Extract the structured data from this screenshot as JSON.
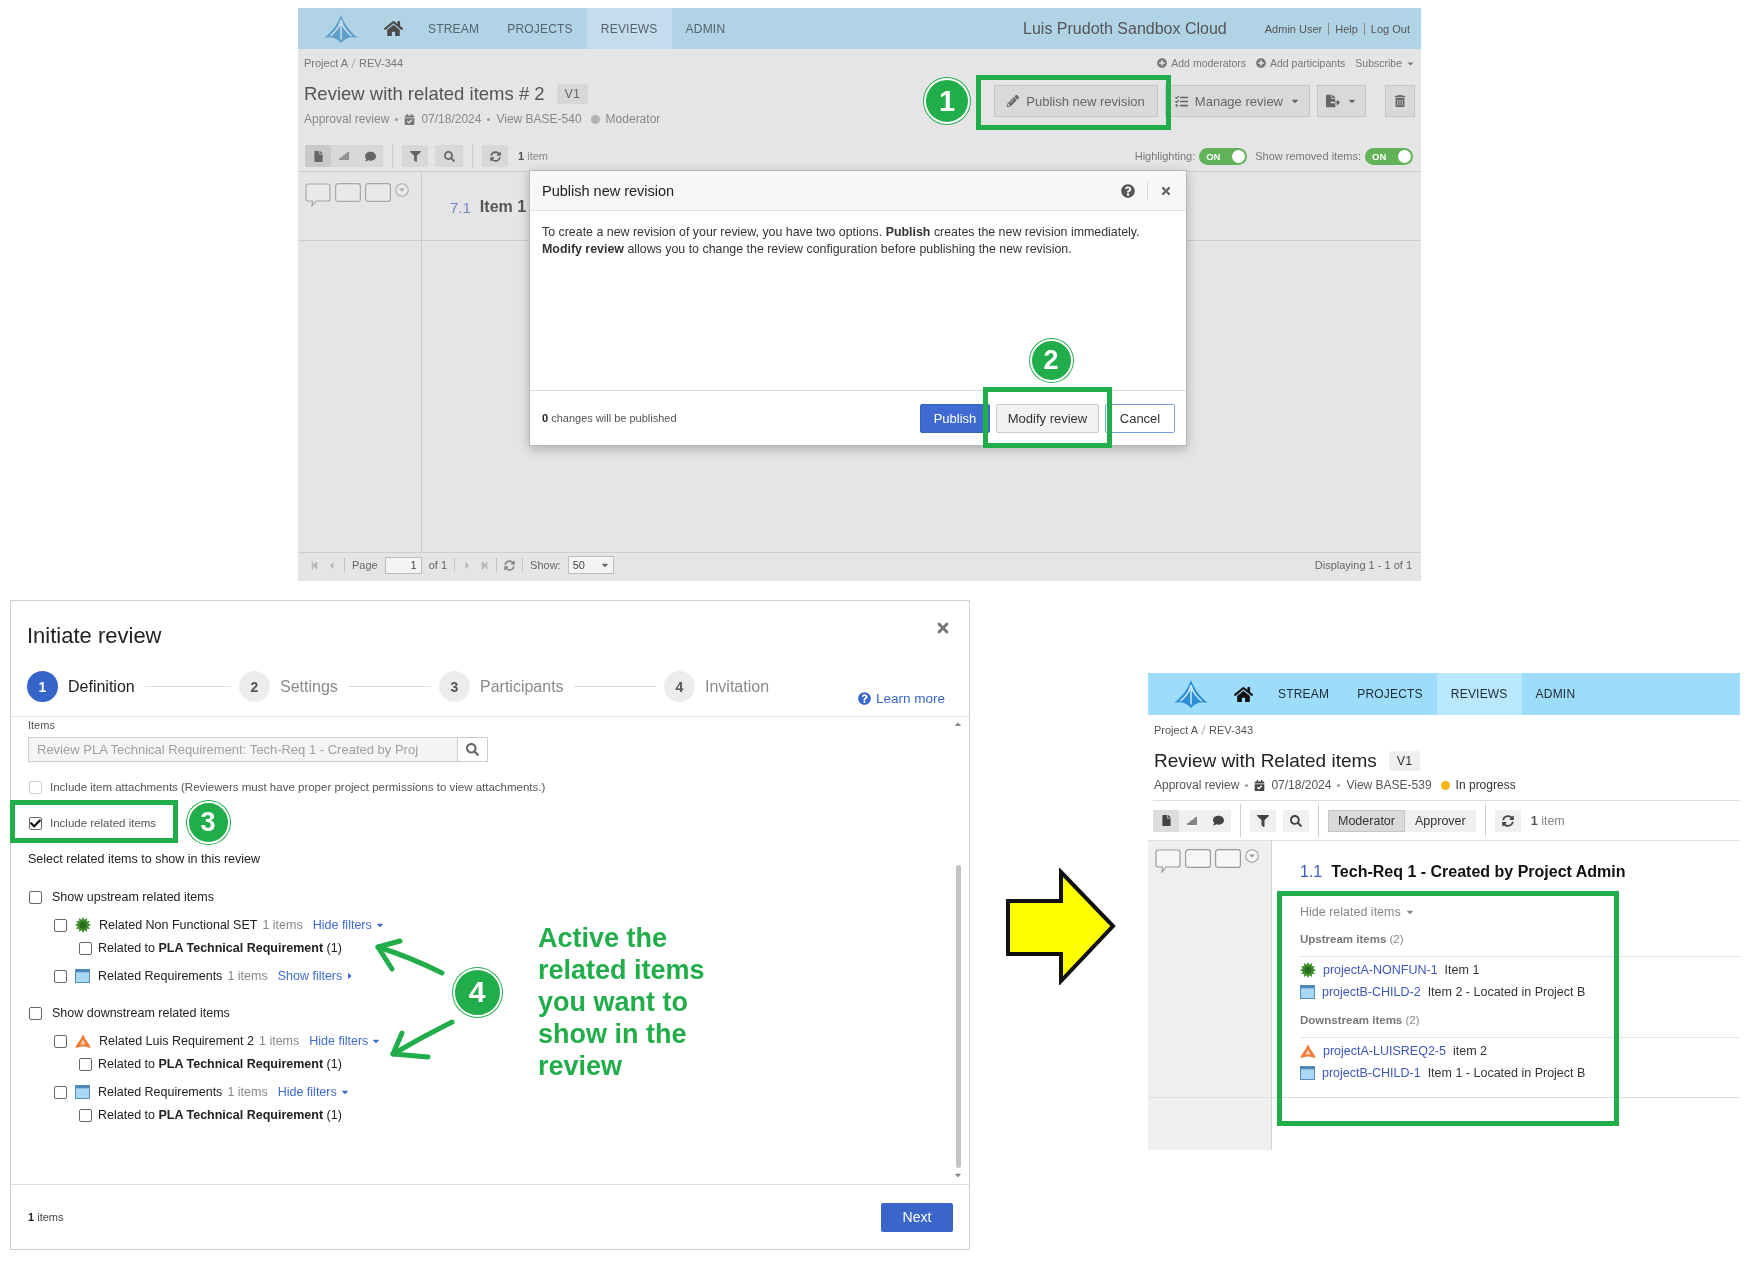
{
  "top_screen": {
    "nav": [
      {
        "label": "STREAM",
        "selected": false
      },
      {
        "label": "PROJECTS",
        "selected": false
      },
      {
        "label": "REVIEWS",
        "selected": true
      },
      {
        "label": "ADMIN",
        "selected": false
      }
    ],
    "site_title": "Luis Prudoth Sandbox Cloud",
    "user_links": [
      "Admin User",
      "Help",
      "Log Out"
    ],
    "breadcrumb": [
      "Project A",
      "REV-344"
    ],
    "header_links": [
      {
        "label": "Add moderators",
        "kind": "add"
      },
      {
        "label": "Add participants",
        "kind": "add"
      },
      {
        "label": "Subscribe",
        "kind": "menu"
      }
    ],
    "title": "Review with related items # 2",
    "version": "V1",
    "meta": {
      "type": "Approval review",
      "date": "07/18/2024",
      "view": "View BASE-540",
      "status": "Moderator",
      "color": "#b3b3b3"
    },
    "actions": {
      "publish": "Publish new revision",
      "manage": "Manage review"
    },
    "views": [
      {
        "kind": "document",
        "selected": true
      },
      {
        "kind": "stats",
        "selected": false
      },
      {
        "kind": "comments",
        "selected": false
      }
    ],
    "item_count": "**1** item",
    "toggles": [
      {
        "label": "Highlighting:",
        "text": "ON",
        "on": true
      },
      {
        "label": "Show removed items:",
        "text": "ON",
        "on": true
      }
    ],
    "item": {
      "number": "7.1",
      "title": "Item 1"
    },
    "pager": {
      "page_label": "Page",
      "page": "1",
      "of": "of 1",
      "show_label": "Show:",
      "show": "50",
      "summary": "Displaying 1 - 1 of 1"
    },
    "modal": {
      "title": "Publish new revision",
      "message": "To create a new revision of your review, you have two options. **Publish** creates the new revision immediately. **Modify review** allows you to change the review configuration before publishing the new revision.",
      "note": "**0** changes will be published",
      "buttons": [
        {
          "label": "Publish",
          "kind": "primary"
        },
        {
          "label": "Modify review",
          "kind": "default"
        },
        {
          "label": "Cancel",
          "kind": "outline"
        }
      ]
    }
  },
  "callouts": [
    "1",
    "2",
    "3",
    "4"
  ],
  "initiate_review": {
    "title": "Initiate review",
    "steps": [
      {
        "number": "1",
        "label": "Definition",
        "selected": true
      },
      {
        "number": "2",
        "label": "Settings",
        "selected": false
      },
      {
        "number": "3",
        "label": "Participants",
        "selected": false
      },
      {
        "number": "4",
        "label": "Invitation",
        "selected": false
      }
    ],
    "learn_more": "Learn more",
    "items_label": "Items",
    "items_value": "Review PLA Technical Requirement: Tech-Req 1 - Created by Proj",
    "items_disabled": true,
    "options": [
      {
        "label": "Include item attachments (Reviewers must have proper project permissions to view attachments.)",
        "checked": false,
        "disabled": true
      },
      {
        "label": "Include related items",
        "checked": true,
        "disabled": false
      }
    ],
    "related_prompt": "Select related items to show in this review",
    "groups": [
      {
        "label": "Show upstream related items",
        "checked": false,
        "items": [
          {
            "kind": "nonfunctional",
            "label": "Related Non Functional SET",
            "count": "1 items",
            "filter_link": "Hide filters",
            "expanded": true,
            "checked": false,
            "filters": [
              {
                "label": "Related to **PLA Technical Requirement** (1)",
                "checked": false
              }
            ]
          },
          {
            "kind": "requirement",
            "label": "Related Requirements",
            "count": "1 items",
            "filter_link": "Show filters",
            "expanded": false,
            "checked": false
          }
        ]
      },
      {
        "label": "Show downstream related items",
        "checked": false,
        "items": [
          {
            "kind": "luis",
            "label": "Related Luis Requirement 2",
            "count": "1 items",
            "filter_link": "Hide filters",
            "expanded": true,
            "checked": false,
            "filters": [
              {
                "label": "Related to **PLA Technical Requirement** (1)",
                "checked": false
              }
            ]
          },
          {
            "kind": "requirement",
            "label": "Related Requirements",
            "count": "1 items",
            "filter_link": "Hide filters",
            "expanded": true,
            "checked": false,
            "filters": [
              {
                "label": "Related to **PLA Technical Requirement** (1)",
                "checked": false
              }
            ]
          }
        ]
      }
    ],
    "footer_count": "**1** items",
    "next": "Next"
  },
  "annotation": "Active the related items you want to show in the review",
  "result_screen": {
    "nav": [
      {
        "label": "STREAM",
        "selected": false
      },
      {
        "label": "PROJECTS",
        "selected": false
      },
      {
        "label": "REVIEWS",
        "selected": true
      },
      {
        "label": "ADMIN",
        "selected": false
      }
    ],
    "breadcrumb": [
      "Project A",
      "REV-343"
    ],
    "title": "Review with Related items",
    "version": "V1",
    "meta": {
      "type": "Approval review",
      "date": "07/18/2024",
      "view": "View BASE-539",
      "status": "In progress",
      "color": "#f7b614"
    },
    "views": [
      {
        "kind": "document",
        "selected": true
      },
      {
        "kind": "stats",
        "selected": false
      },
      {
        "kind": "comments",
        "selected": false
      }
    ],
    "roles": [
      {
        "label": "Moderator",
        "selected": true
      },
      {
        "label": "Approver",
        "selected": false
      }
    ],
    "item_count": "**1** item",
    "item": {
      "number": "1.1",
      "title": "Tech-Req 1 - Created by Project Admin"
    },
    "related_toggle": "Hide related items",
    "sections": [
      {
        "heading": "**Upstream items** (2)",
        "items": [
          {
            "kind": "nonfunctional",
            "id": "projectA-NONFUN-1",
            "name": "Item 1"
          },
          {
            "kind": "requirement",
            "id": "projectB-CHILD-2",
            "name": "Item 2 - Located in Project B"
          }
        ]
      },
      {
        "heading": "**Downstream items** (2)",
        "items": [
          {
            "kind": "luis",
            "id": "projectA-LUISREQ2-5",
            "name": "item 2"
          },
          {
            "kind": "requirement",
            "id": "projectB-CHILD-1",
            "name": "Item 1 - Located in Project B"
          }
        ]
      }
    ]
  }
}
